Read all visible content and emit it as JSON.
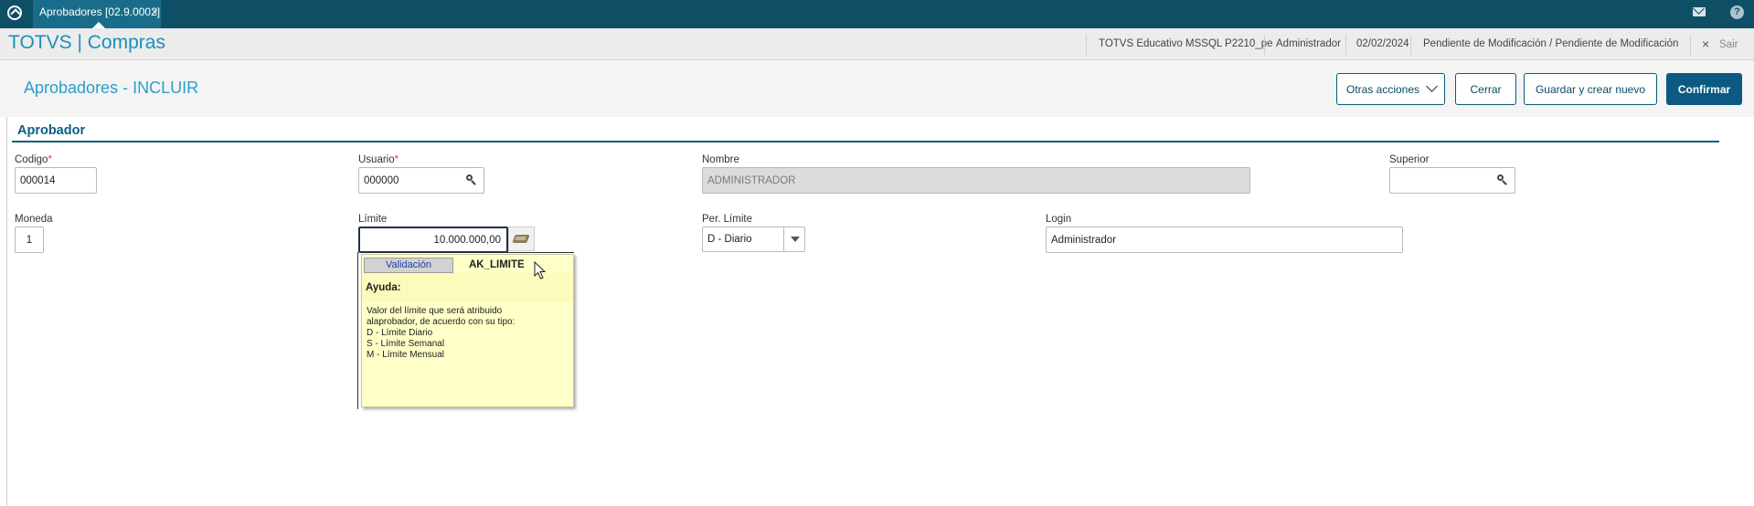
{
  "tabbar": {
    "tab_label": "Aprobadores [02.9.0002]",
    "tab_close": "×"
  },
  "header": {
    "brand": "TOTVS | Compras",
    "environment": "TOTVS Educativo MSSQL P2210_pe",
    "user": "Administrador",
    "date": "02/02/2024",
    "status": "Pendiente de Modificación / Pendiente de Modificación",
    "exit_icon": "×",
    "exit_label": "Sair"
  },
  "titlebar": {
    "title": "Aprobadores - INCLUIR",
    "buttons": {
      "more": "Otras acciones",
      "close": "Cerrar",
      "save_new": "Guardar y crear nuevo",
      "confirm": "Confirmar"
    }
  },
  "section": {
    "title": "Aprobador"
  },
  "form": {
    "codigo": {
      "label": "Codigo",
      "required": "*",
      "value": "000014"
    },
    "usuario": {
      "label": "Usuario",
      "required": "*",
      "value": "000000"
    },
    "nombre": {
      "label": "Nombre",
      "value": "ADMINISTRADOR"
    },
    "superior": {
      "label": "Superior",
      "value": ""
    },
    "moneda": {
      "label": "Moneda",
      "value": "1"
    },
    "limite": {
      "label": "Límite",
      "value": "10.000.000,00"
    },
    "per_limite": {
      "label": "Per. Límite",
      "value": "D - Diario"
    },
    "login": {
      "label": "Login",
      "value": "Administrador"
    }
  },
  "tooltip": {
    "tab": "Validación",
    "field_code": "AK_LIMITE",
    "help_title": "Ayuda:",
    "help_text": "Valor del límite que será atribuido\nalaprobador, de acuerdo con su tipo:\nD - Límite Diario\nS - Límite Semanal\nM - Límite Mensual"
  },
  "icons": {
    "app_logo": "app-logo-icon",
    "mail": "mail-icon",
    "help": "help-icon",
    "search": "search-icon",
    "calculator": "calculator-icon",
    "dropdown": "chevron-down-icon"
  },
  "colors": {
    "tabbar": "#0f4f66",
    "brand": "#1a8fbb",
    "primary_button": "#0c5a82",
    "tooltip": "#ffffc8",
    "required": "#d23a3a"
  }
}
